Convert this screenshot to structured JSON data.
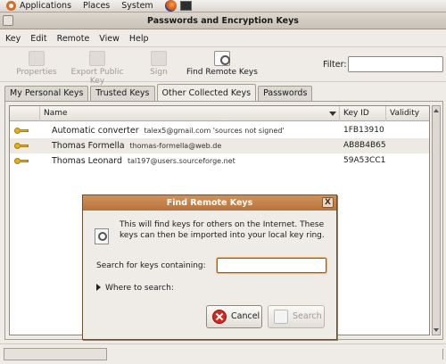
{
  "panel": {
    "menus": [
      "Applications",
      "Places",
      "System"
    ]
  },
  "window": {
    "title": "Passwords and Encryption Keys"
  },
  "menubar": [
    "Key",
    "Edit",
    "Remote",
    "View",
    "Help"
  ],
  "toolbar": {
    "properties": "Properties",
    "export": "Export Public Key",
    "sign": "Sign",
    "find_remote": "Find Remote Keys",
    "filter_label": "Filter:",
    "filter_value": ""
  },
  "tabs": [
    "My Personal Keys",
    "Trusted Keys",
    "Other Collected Keys",
    "Passwords"
  ],
  "table": {
    "columns": {
      "name": "Name",
      "key_id": "Key ID",
      "validity": "Validity"
    },
    "rows": [
      {
        "name": "Automatic converter",
        "detail": "talex5@gmail.com  'sources not signed'",
        "key_id": "1FB13910"
      },
      {
        "name": "Thomas Formella",
        "detail": "thomas-formella@web.de",
        "key_id": "AB8B4B65"
      },
      {
        "name": "Thomas Leonard",
        "detail": "tal197@users.sourceforge.net",
        "key_id": "59A53CC1"
      }
    ]
  },
  "dialog": {
    "title": "Find Remote Keys",
    "close": "X",
    "message": "This will find keys for others on the Internet. These keys can then be imported into your local key ring.",
    "search_label": "Search for keys containing:",
    "search_value": "",
    "where_label": "Where to search:",
    "cancel_label": "Cancel",
    "search_button_label": "Search"
  }
}
